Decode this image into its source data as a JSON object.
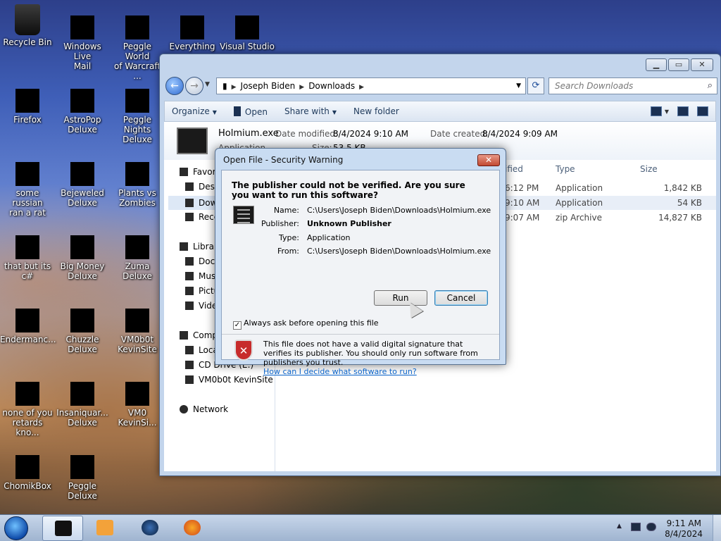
{
  "desktop": {
    "icons": [
      {
        "label": "Recycle Bin",
        "label2": ""
      },
      {
        "label": "Windows Live",
        "label2": "Mail"
      },
      {
        "label": "Peggle World",
        "label2": "of Warcraft ..."
      },
      {
        "label": "Everything",
        "label2": ""
      },
      {
        "label": "Visual Studio",
        "label2": ""
      },
      {
        "label": "Firefox",
        "label2": ""
      },
      {
        "label": "AstroPop",
        "label2": "Deluxe"
      },
      {
        "label": "Peggle Nights",
        "label2": "Deluxe"
      },
      {
        "label": "some russian",
        "label2": "ran a rat"
      },
      {
        "label": "Bejeweled",
        "label2": "Deluxe"
      },
      {
        "label": "Plants vs",
        "label2": "Zombies"
      },
      {
        "label": "that but its c#",
        "label2": ""
      },
      {
        "label": "Big Money",
        "label2": "Deluxe"
      },
      {
        "label": "Zuma Deluxe",
        "label2": ""
      },
      {
        "label": "Endermanc...",
        "label2": ""
      },
      {
        "label": "Chuzzle",
        "label2": "Deluxe"
      },
      {
        "label": "VM0b0t",
        "label2": "KevinSite"
      },
      {
        "label": "none of you",
        "label2": "retards kno..."
      },
      {
        "label": "Insaniquar...",
        "label2": "Deluxe"
      },
      {
        "label": "VM0",
        "label2": "KevinSi..."
      },
      {
        "label": "ChomikBox",
        "label2": ""
      },
      {
        "label": "Peggle Deluxe",
        "label2": ""
      }
    ]
  },
  "explorer": {
    "address": {
      "seg1": "Joseph Biden",
      "seg2": "Downloads"
    },
    "search_placeholder": "Search Downloads",
    "toolbar": {
      "organize": "Organize",
      "open": "Open",
      "share": "Share with",
      "newfolder": "New folder"
    },
    "details": {
      "filename": "Holmium.exe",
      "modified_label": "Date modified:",
      "modified_value": "8/4/2024 9:10 AM",
      "created_label": "Date created:",
      "created_value": "8/4/2024 9:09 AM",
      "app_label": "Application",
      "size_label": "Size:",
      "size_value": "53.5 KB"
    },
    "nav": {
      "favorites": "Favori",
      "desktop": "Desk",
      "downloads": "Dow",
      "recent": "Rece",
      "libraries": "Librari",
      "documents": "Doc",
      "music": "Mus",
      "pictures": "Pictu",
      "videos": "Vide",
      "computer": "Comp",
      "local": "Loca",
      "cddrive": "CD Drive (E:)",
      "vmbot": "VM0b0t KevinSite",
      "network": "Network"
    },
    "columns": {
      "modified": "ified",
      "type": "Type",
      "size": "Size"
    },
    "rows": [
      {
        "time": "6:12 PM",
        "type": "Application",
        "size": "1,842 KB"
      },
      {
        "time": "9:10 AM",
        "type": "Application",
        "size": "54 KB"
      },
      {
        "time": "9:07 AM",
        "type": "zip Archive",
        "size": "14,827 KB"
      }
    ]
  },
  "dialog": {
    "title": "Open File - Security Warning",
    "headline": "The publisher could not be verified.  Are you sure you want to run this software?",
    "name_label": "Name:",
    "name_value": "C:\\Users\\Joseph Biden\\Downloads\\Holmium.exe",
    "publisher_label": "Publisher:",
    "publisher_value": "Unknown Publisher",
    "type_label": "Type:",
    "type_value": "Application",
    "from_label": "From:",
    "from_value": "C:\\Users\\Joseph Biden\\Downloads\\Holmium.exe",
    "run_label": "Run",
    "cancel_label": "Cancel",
    "checkbox_label": "Always ask before opening this file",
    "warning_text": "This file does not have a valid digital signature that verifies its publisher.  You should only run software from publishers you trust.",
    "help_link": "How can I decide what software to run?"
  },
  "taskbar": {
    "time": "9:11 AM",
    "date": "8/4/2024"
  }
}
